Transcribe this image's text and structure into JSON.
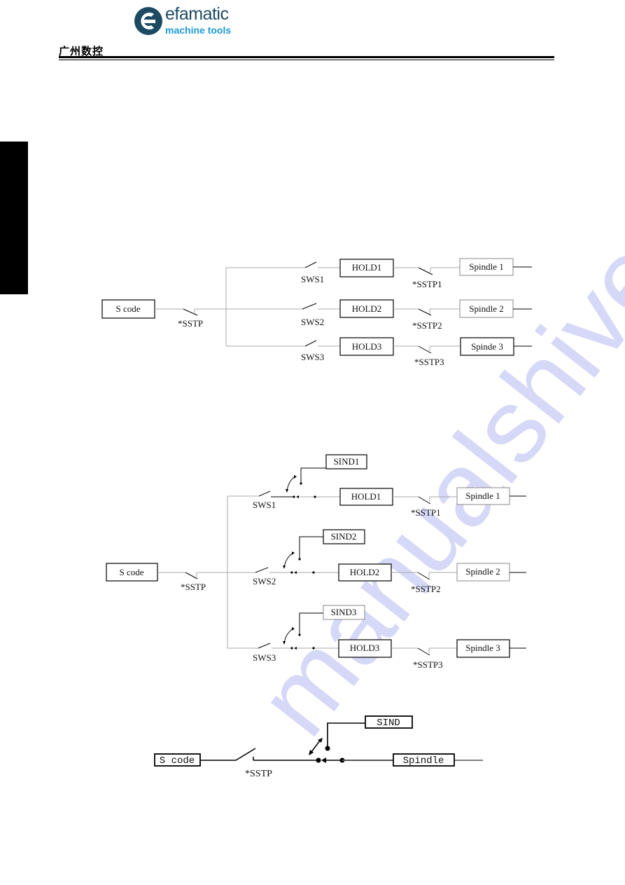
{
  "header": {
    "brand_name": "efamatic",
    "brand_tagline": "machine tools",
    "publisher_logo_text": "广州数控",
    "colors": {
      "brand_dark": "#1c4a63",
      "brand_light": "#1e9ad6"
    }
  },
  "watermark": "manualshive.com",
  "diagram1": {
    "source": "S code",
    "source_switch": "*SSTP",
    "branches": [
      {
        "switch": "SWS1",
        "hold": "HOLD1",
        "stop": "*SSTP1",
        "spindle": "Spindle 1"
      },
      {
        "switch": "SWS2",
        "hold": "HOLD2",
        "stop": "*SSTP2",
        "spindle": "Spindle 2"
      },
      {
        "switch": "SWS3",
        "hold": "HOLD3",
        "stop": "*SSTP3",
        "spindle": "Spinde 3"
      }
    ]
  },
  "diagram2": {
    "source": "S code",
    "source_switch": "*SSTP",
    "branches": [
      {
        "switch": "SWS1",
        "select": "SIND1",
        "hold": "HOLD1",
        "stop": "*SSTP1",
        "spindle": "Spindle 1"
      },
      {
        "switch": "SWS2",
        "select": "SIND2",
        "hold": "HOLD2",
        "stop": "*SSTP2",
        "spindle": "Spindle 2"
      },
      {
        "switch": "SWS3",
        "select": "SIND3",
        "hold": "HOLD3",
        "stop": "*SSTP3",
        "spindle": "Spindle 3"
      }
    ]
  },
  "diagram3": {
    "source": "S code",
    "source_switch": "*SSTP",
    "select": "SIND",
    "spindle": "Spindle"
  }
}
